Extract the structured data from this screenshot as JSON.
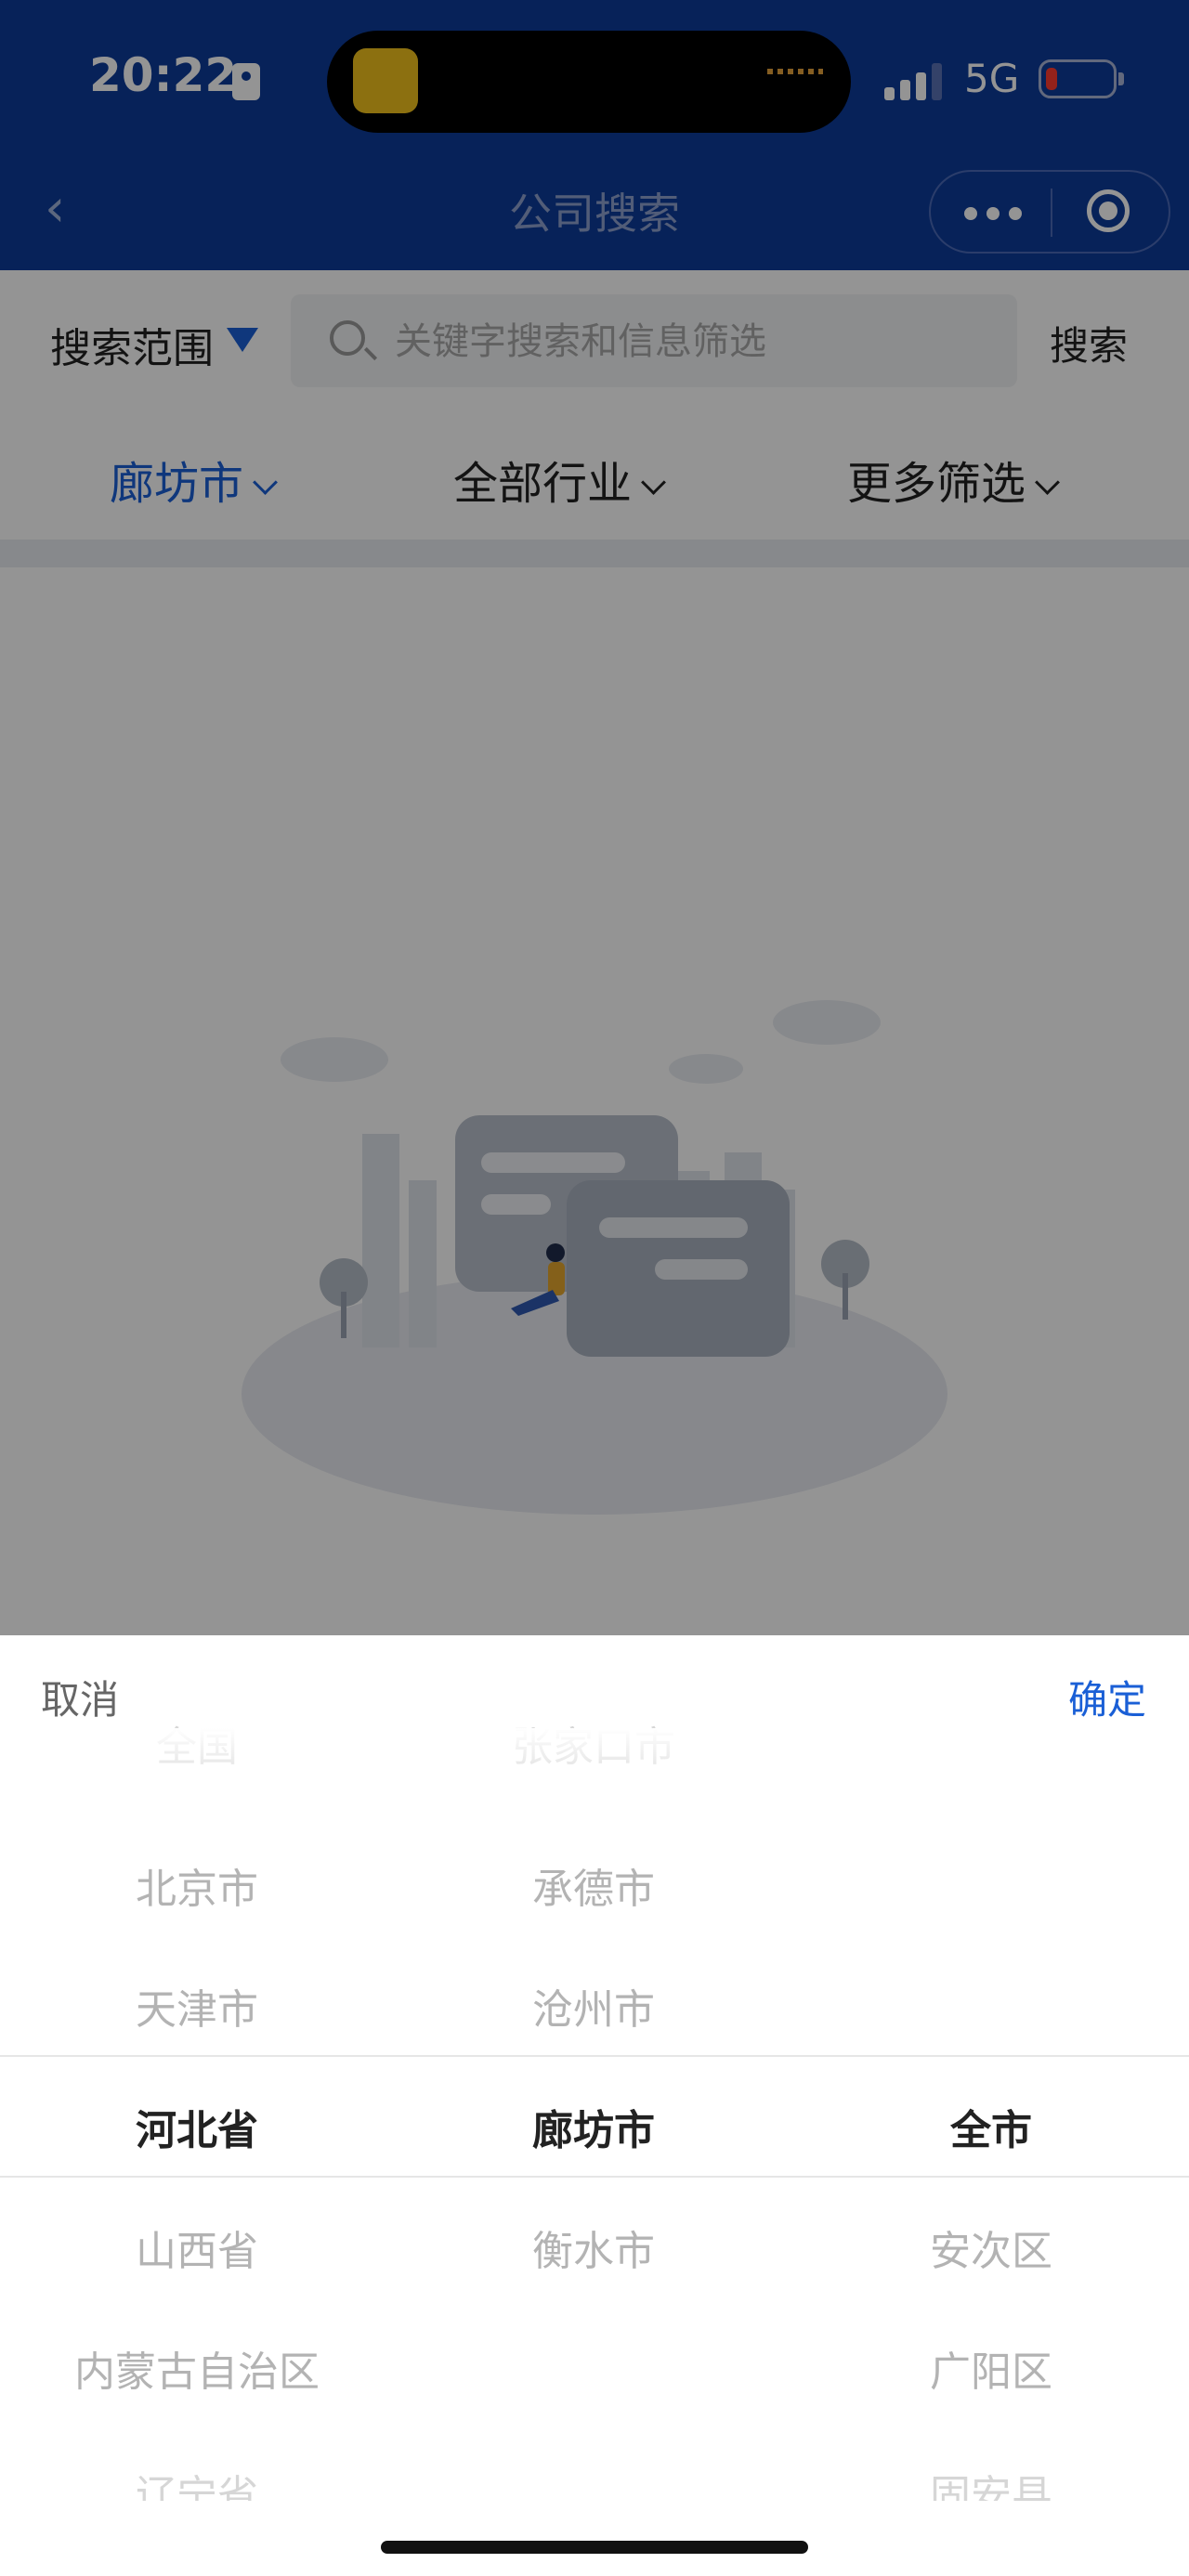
{
  "status_bar": {
    "time": "20:22",
    "network": "5G",
    "icons": [
      "contact-card-icon",
      "signal-icon",
      "battery-low-icon"
    ]
  },
  "nav": {
    "title": "公司搜索",
    "back_icon": "chevron-left-icon",
    "capsule_icons": [
      "more-dots-icon",
      "target-icon"
    ]
  },
  "search": {
    "scope_label": "搜索范围",
    "placeholder": "关键字搜索和信息筛选",
    "value": "",
    "button": "搜索"
  },
  "filters": [
    {
      "label": "廊坊市",
      "active": true
    },
    {
      "label": "全部行业",
      "active": false
    },
    {
      "label": "更多筛选",
      "active": false
    }
  ],
  "picker": {
    "cancel": "取消",
    "confirm": "确定",
    "provinces": [
      "全国",
      "北京市",
      "天津市",
      "河北省",
      "山西省",
      "内蒙古自治区",
      "辽宁省"
    ],
    "cities": [
      "张家口市",
      "承德市",
      "沧州市",
      "廊坊市",
      "衡水市"
    ],
    "districts": [
      "全市",
      "安次区",
      "广阳区",
      "固安县"
    ],
    "selected": {
      "province": "河北省",
      "city": "廊坊市",
      "district": "全市"
    }
  },
  "colors": {
    "brand_blue": "#0d3b99",
    "accent": "#1a5fd6"
  }
}
